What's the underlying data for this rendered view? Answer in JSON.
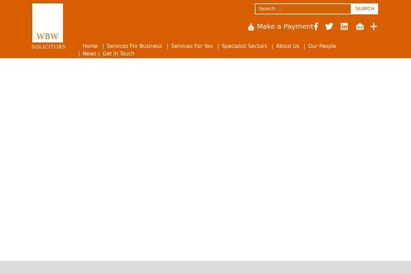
{
  "brand": {
    "logo_text": "WBW",
    "logo_subtitle": "SOLICITORS"
  },
  "search": {
    "placeholder": "Search ...",
    "button_label": "SEARCH"
  },
  "payment": {
    "label": "Make a Payment",
    "icon": "money-bag-icon"
  },
  "social": [
    {
      "name": "facebook-icon"
    },
    {
      "name": "twitter-icon"
    },
    {
      "name": "linkedin-icon"
    },
    {
      "name": "email-icon"
    },
    {
      "name": "plus-icon"
    }
  ],
  "nav": {
    "items": [
      {
        "label": "Home"
      },
      {
        "label": "Services For Business"
      },
      {
        "label": "Services For You"
      },
      {
        "label": "Specialist Sectors"
      },
      {
        "label": "About Us"
      },
      {
        "label": "Our People"
      },
      {
        "label": "News"
      },
      {
        "label": "Get In Touch"
      }
    ],
    "separator": "|"
  },
  "colors": {
    "header_bg": "#d95e00",
    "footer_strip": "#dcdcdc",
    "text_on_header": "#ffffff"
  }
}
